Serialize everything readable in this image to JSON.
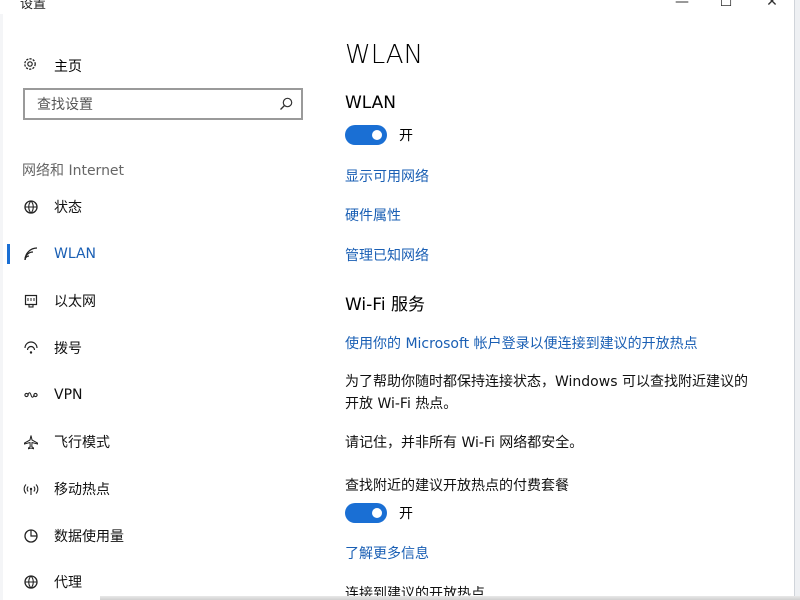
{
  "window": {
    "title": "设置",
    "controls": {
      "minimize": "—",
      "maximize": "☐",
      "close": "✕"
    }
  },
  "sidebar": {
    "home_label": "主页",
    "search_placeholder": "查找设置",
    "section_label": "网络和 Internet",
    "items": [
      {
        "id": "status",
        "label": "状态",
        "icon": "globe-status-icon"
      },
      {
        "id": "wlan",
        "label": "WLAN",
        "icon": "wifi-icon",
        "selected": true
      },
      {
        "id": "ethernet",
        "label": "以太网",
        "icon": "ethernet-icon"
      },
      {
        "id": "dialup",
        "label": "拨号",
        "icon": "dialup-icon"
      },
      {
        "id": "vpn",
        "label": "VPN",
        "icon": "vpn-icon"
      },
      {
        "id": "airplane",
        "label": "飞行模式",
        "icon": "airplane-icon"
      },
      {
        "id": "hotspot",
        "label": "移动热点",
        "icon": "hotspot-icon"
      },
      {
        "id": "datausage",
        "label": "数据使用量",
        "icon": "data-usage-icon"
      },
      {
        "id": "proxy",
        "label": "代理",
        "icon": "proxy-globe-icon"
      }
    ]
  },
  "main": {
    "page_title": "WLAN",
    "wlan_heading": "WLAN",
    "wlan_toggle_label": "开",
    "links": {
      "show_networks": "显示可用网络",
      "hardware_properties": "硬件属性",
      "manage_known": "管理已知网络"
    },
    "wifi_services_heading": "Wi-Fi 服务",
    "ms_account_link": "使用你的 Microsoft 帐户登录以便连接到建议的开放热点",
    "description_line1": "为了帮助你随时都保持连接状态，Windows 可以查找附近建议的",
    "description_line2": "开放 Wi-Fi 热点。",
    "warning": "请记住，并非所有 Wi-Fi 网络都安全。",
    "paid_plans_label": "查找附近的建议开放热点的付费套餐",
    "paid_toggle_label": "开",
    "learn_more": "了解更多信息",
    "connect_label": "连接到建议的开放热点"
  },
  "colors": {
    "accent": "#1a6fd4",
    "link": "#1a5fb4"
  }
}
